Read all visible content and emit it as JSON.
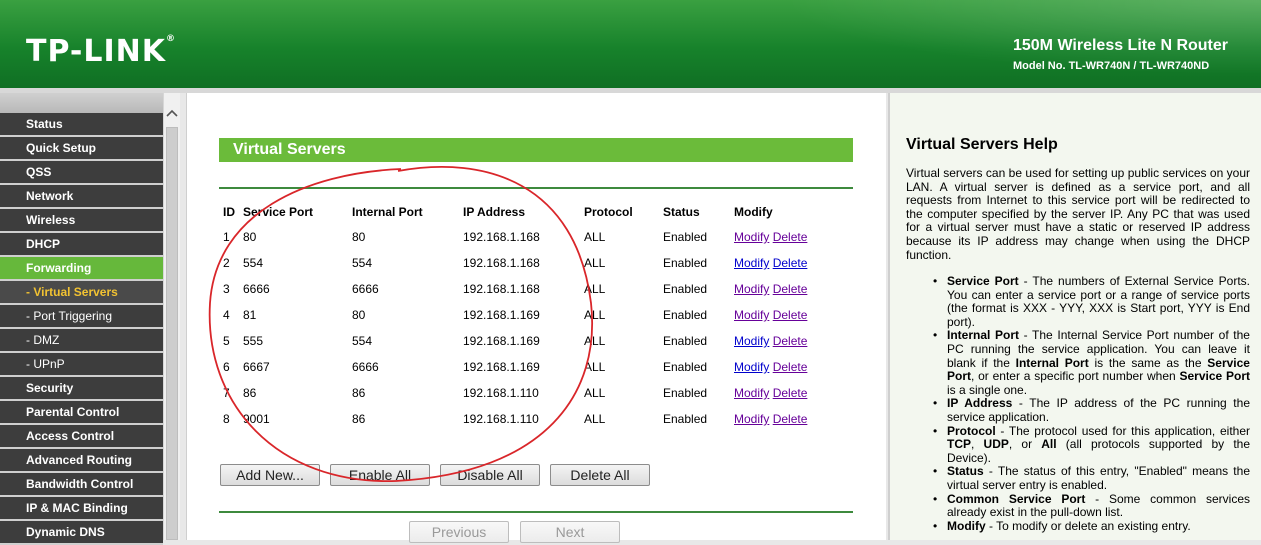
{
  "header": {
    "logo": "TP-LINK",
    "product_name": "150M Wireless Lite N Router",
    "model": "Model No. TL-WR740N / TL-WR740ND"
  },
  "sidebar": {
    "items": [
      {
        "label": "Status"
      },
      {
        "label": "Quick Setup"
      },
      {
        "label": "QSS"
      },
      {
        "label": "Network"
      },
      {
        "label": "Wireless"
      },
      {
        "label": "DHCP"
      },
      {
        "label": "Forwarding"
      },
      {
        "label": "- Virtual Servers"
      },
      {
        "label": "- Port Triggering"
      },
      {
        "label": "- DMZ"
      },
      {
        "label": "- UPnP"
      },
      {
        "label": "Security"
      },
      {
        "label": "Parental Control"
      },
      {
        "label": "Access Control"
      },
      {
        "label": "Advanced Routing"
      },
      {
        "label": "Bandwidth Control"
      },
      {
        "label": "IP & MAC Binding"
      },
      {
        "label": "Dynamic DNS"
      }
    ]
  },
  "main": {
    "title": "Virtual Servers",
    "columns": [
      "ID",
      "Service Port",
      "Internal Port",
      "IP Address",
      "Protocol",
      "Status",
      "Modify"
    ],
    "rows": [
      {
        "id": "1",
        "service_port": "80",
        "internal_port": "80",
        "ip": "192.168.1.168",
        "protocol": "ALL",
        "status": "Enabled"
      },
      {
        "id": "2",
        "service_port": "554",
        "internal_port": "554",
        "ip": "192.168.1.168",
        "protocol": "ALL",
        "status": "Enabled"
      },
      {
        "id": "3",
        "service_port": "6666",
        "internal_port": "6666",
        "ip": "192.168.1.168",
        "protocol": "ALL",
        "status": "Enabled"
      },
      {
        "id": "4",
        "service_port": "81",
        "internal_port": "80",
        "ip": "192.168.1.169",
        "protocol": "ALL",
        "status": "Enabled"
      },
      {
        "id": "5",
        "service_port": "555",
        "internal_port": "554",
        "ip": "192.168.1.169",
        "protocol": "ALL",
        "status": "Enabled"
      },
      {
        "id": "6",
        "service_port": "6667",
        "internal_port": "6666",
        "ip": "192.168.1.169",
        "protocol": "ALL",
        "status": "Enabled"
      },
      {
        "id": "7",
        "service_port": "86",
        "internal_port": "86",
        "ip": "192.168.1.110",
        "protocol": "ALL",
        "status": "Enabled"
      },
      {
        "id": "8",
        "service_port": "9001",
        "internal_port": "86",
        "ip": "192.168.1.110",
        "protocol": "ALL",
        "status": "Enabled"
      }
    ],
    "modify_label": "Modify",
    "delete_label": "Delete",
    "buttons": {
      "add_new": "Add New...",
      "enable_all": "Enable All",
      "disable_all": "Disable All",
      "delete_all": "Delete All",
      "previous": "Previous",
      "next": "Next"
    }
  },
  "help": {
    "title": "Virtual Servers Help",
    "intro": "Virtual servers can be used for setting up public services on your LAN. A virtual server is defined as a service port, and all requests from Internet to this service port will be redirected to the computer specified by the server IP. Any PC that was used for a virtual server must have a static or reserved IP address because its IP address may change when using the DHCP function.",
    "items": {
      "service_port_term": "Service Port",
      "service_port_text": " - The numbers of External Service Ports. You can enter a service port or a range of service ports (the format is XXX - YYY, XXX is Start port, YYY is End port).",
      "internal_port_term": "Internal Port",
      "internal_port_text1": " - The Internal Service Port number of the PC running the service application. You can leave it blank if the ",
      "internal_port_inline1": "Internal Port",
      "internal_port_text2": " is the same as the ",
      "internal_port_inline2": "Service Port",
      "internal_port_text3": ", or enter a specific port number when ",
      "internal_port_inline3": "Service Port",
      "internal_port_text4": " is a single one.",
      "ip_term": "IP Address",
      "ip_text": " - The IP address of the PC running the service application.",
      "protocol_term": "Protocol",
      "protocol_text1": " - The protocol used for this application, either ",
      "protocol_tcp": "TCP",
      "protocol_comma": ", ",
      "protocol_udp": "UDP",
      "protocol_text2": ", or ",
      "protocol_all": "All",
      "protocol_text3": " (all protocols supported by the Device).",
      "status_term": "Status",
      "status_text": " - The status of this entry, \"Enabled\" means the virtual server entry is enabled.",
      "common_term": "Common Service Port",
      "common_text": " - Some common services already exist in the pull-down list.",
      "modify_term": "Modify",
      "modify_text": " - To modify or delete an existing entry."
    }
  },
  "colors": {
    "header_green": "#17822b",
    "menu_active": "#66b83b",
    "title_bar": "#6bbb3a",
    "annotation_circle": "#d9262a"
  }
}
